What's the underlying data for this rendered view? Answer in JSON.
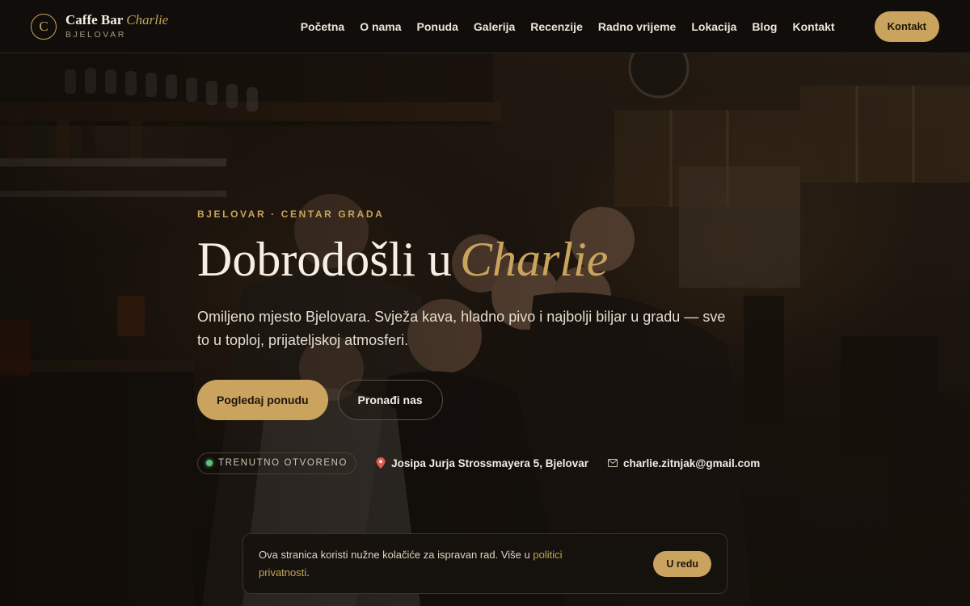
{
  "brand": {
    "mark": "C",
    "name": "Caffe Bar",
    "name_accent": "Charlie",
    "city": "BJELOVAR"
  },
  "nav": {
    "items": [
      {
        "label": "Početna"
      },
      {
        "label": "O nama"
      },
      {
        "label": "Ponuda"
      },
      {
        "label": "Galerija"
      },
      {
        "label": "Recenzije"
      },
      {
        "label": "Radno vrijeme"
      },
      {
        "label": "Lokacija"
      },
      {
        "label": "Blog"
      },
      {
        "label": "Kontakt"
      }
    ],
    "cta_label": "Kontakt"
  },
  "hero": {
    "eyebrow": "BJELOVAR · CENTAR GRADA",
    "title": "Dobrodošli u",
    "title_accent": "Charlie",
    "lead": "Omiljeno mjesto Bjelovara. Svježa kava, hladno pivo i najbolji biljar u gradu — sve to u toploj, prijateljskoj atmosferi.",
    "primary_button": "Pogledaj ponudu",
    "secondary_button": "Pronađi nas",
    "status": "TRENUTNO OTVORENO",
    "address": "Josipa Jurja Strossmayera 5, Bjelovar",
    "email": "charlie.zitnjak@gmail.com"
  },
  "cookie": {
    "text": "Ova stranica koristi nužne kolačiće za ispravan rad. Više u ",
    "link": "politici privatnosti",
    "suffix": ".",
    "button": "U redu"
  },
  "colors": {
    "accent": "#caa45f",
    "background": "#100d0a",
    "status_open": "#5bc47c"
  },
  "icons": {
    "address": "pin-icon",
    "email": "mail-icon",
    "status": "status-dot-icon"
  }
}
